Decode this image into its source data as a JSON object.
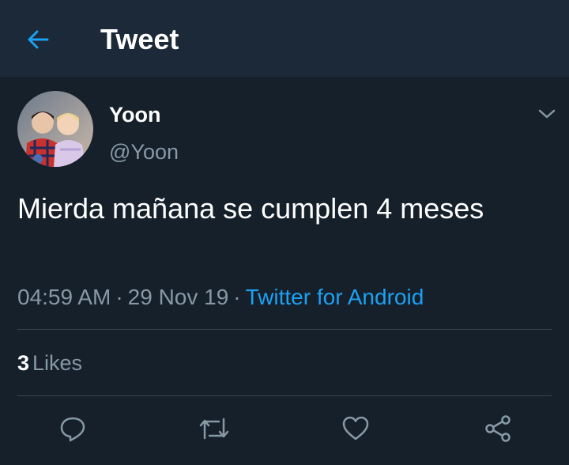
{
  "header": {
    "title": "Tweet",
    "back_icon": "arrow-left-icon"
  },
  "tweet": {
    "display_name": "Yoon",
    "handle": "@Yoon",
    "text": "Mierda mañana se cumplen 4 meses",
    "time": "04:59 AM",
    "date": "29 Nov 19",
    "source": "Twitter for Android",
    "separator": "·",
    "likes_count": "3",
    "likes_label": "Likes"
  },
  "actions": {
    "reply_icon": "reply-icon",
    "retweet_icon": "retweet-icon",
    "like_icon": "heart-icon",
    "share_icon": "share-icon"
  },
  "colors": {
    "background": "#15202b",
    "header": "#1c2938",
    "accent": "#1da1f2",
    "secondary_text": "#8899a6",
    "divider": "#38444d"
  }
}
